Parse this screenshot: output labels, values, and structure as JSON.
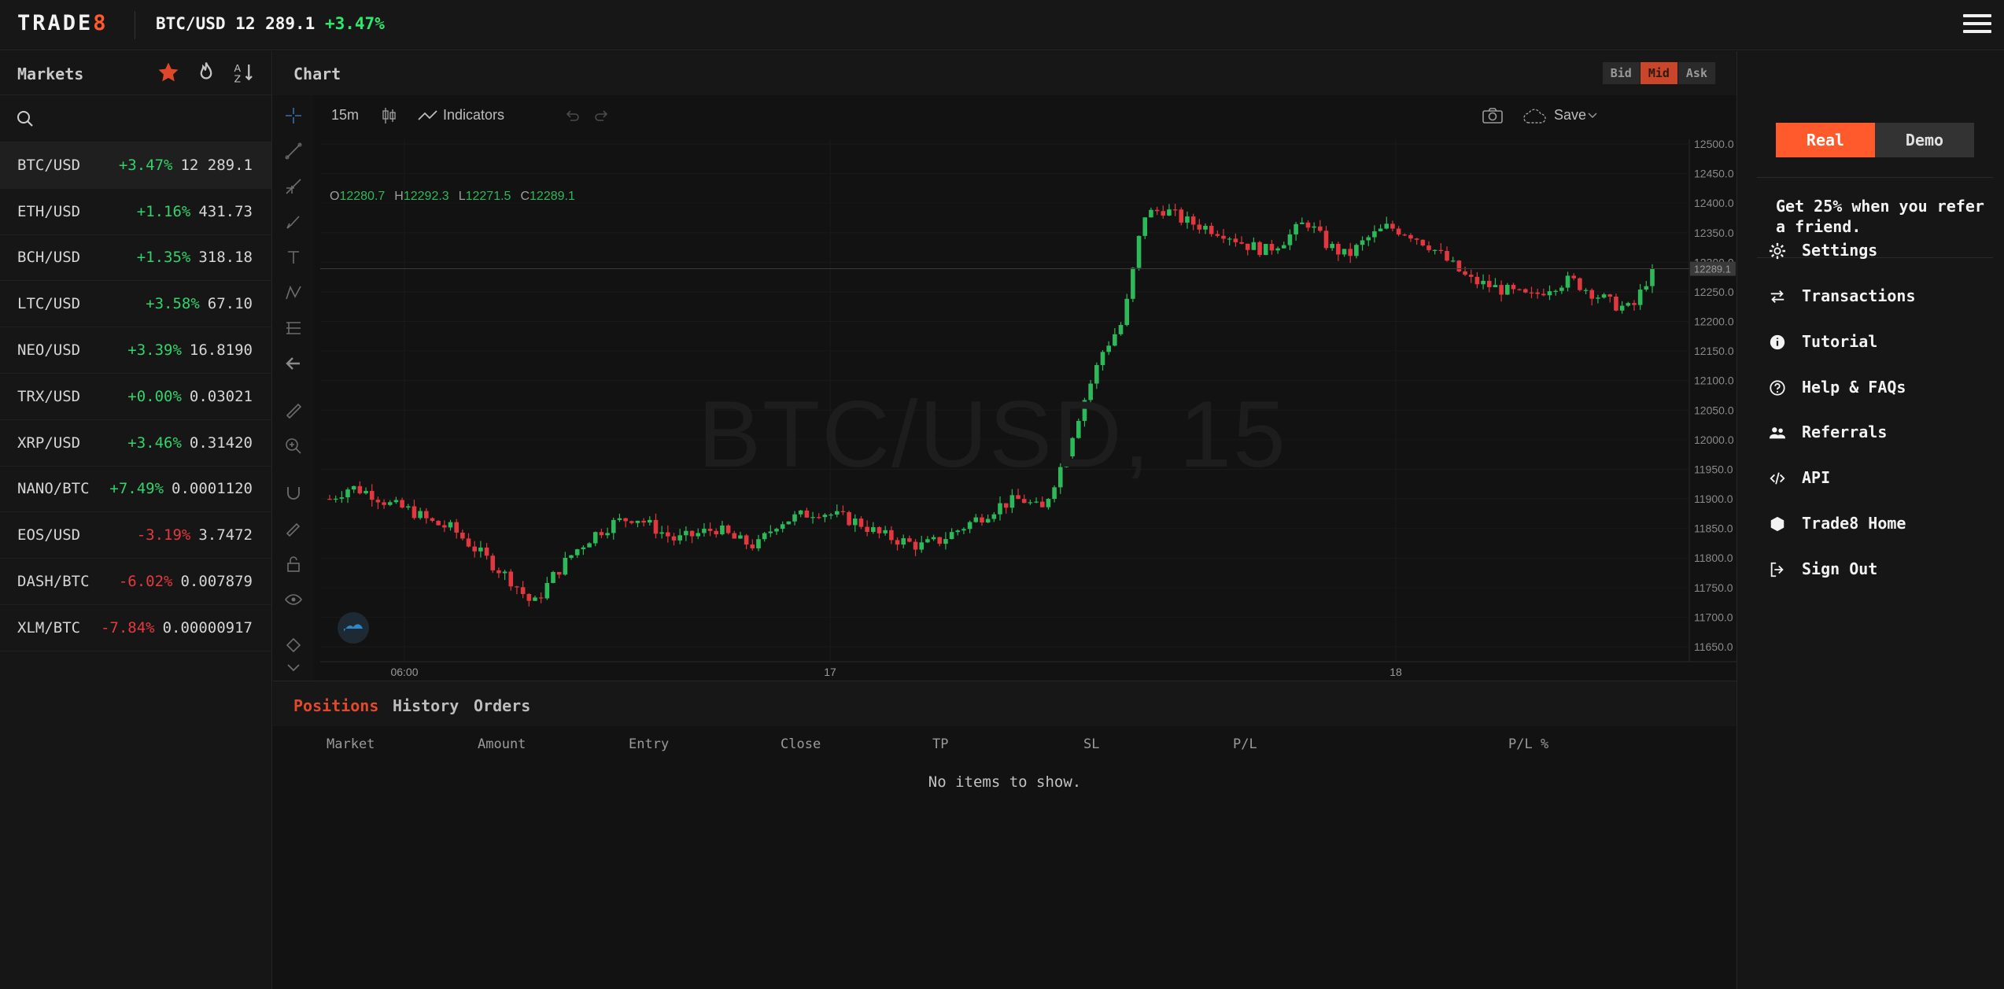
{
  "topbar": {
    "logo": "TRADE",
    "logo_accent": "8",
    "ticker_symbol": "BTC/USD",
    "ticker_price": "12 289.1",
    "ticker_change": "+3.47%"
  },
  "markets": {
    "title": "Markets",
    "search_placeholder": "",
    "rows": [
      {
        "symbol": "BTC/USD",
        "change": "+3.47%",
        "price": "12 289.1",
        "dir": "up",
        "active": true
      },
      {
        "symbol": "ETH/USD",
        "change": "+1.16%",
        "price": "431.73",
        "dir": "up"
      },
      {
        "symbol": "BCH/USD",
        "change": "+1.35%",
        "price": "318.18",
        "dir": "up"
      },
      {
        "symbol": "LTC/USD",
        "change": "+3.58%",
        "price": "67.10",
        "dir": "up"
      },
      {
        "symbol": "NEO/USD",
        "change": "+3.39%",
        "price": "16.8190",
        "dir": "up"
      },
      {
        "symbol": "TRX/USD",
        "change": "+0.00%",
        "price": "0.03021",
        "dir": "flat"
      },
      {
        "symbol": "XRP/USD",
        "change": "+3.46%",
        "price": "0.31420",
        "dir": "up"
      },
      {
        "symbol": "NANO/BTC",
        "change": "+7.49%",
        "price": "0.0001120",
        "dir": "up"
      },
      {
        "symbol": "EOS/USD",
        "change": "-3.19%",
        "price": "3.7472",
        "dir": "down"
      },
      {
        "symbol": "DASH/BTC",
        "change": "-6.02%",
        "price": "0.007879",
        "dir": "down"
      },
      {
        "symbol": "XLM/BTC",
        "change": "-7.84%",
        "price": "0.00000917",
        "dir": "down"
      }
    ]
  },
  "chart": {
    "title": "Chart",
    "price_modes": [
      "Bid",
      "Mid",
      "Ask"
    ],
    "active_mode": "Mid",
    "interval": "15m",
    "indicators_label": "Indicators",
    "save_label": "Save",
    "watermark": "BTC/USD, 15",
    "ohlc": {
      "o_label": "O",
      "o": "12280.7",
      "h_label": "H",
      "h": "12292.3",
      "l_label": "L",
      "l": "12271.5",
      "c_label": "C",
      "c": "12289.1"
    },
    "current_price_tag": "12289.1",
    "colors": {
      "up": "#2db85a",
      "down": "#e0383e",
      "accent": "#ff5a2c"
    }
  },
  "chart_data": {
    "type": "candlestick",
    "title": "",
    "xlabel": "",
    "ylabel": "",
    "ylim": [
      11650,
      12500
    ],
    "y_ticks": [
      "12500.0",
      "12450.0",
      "12400.0",
      "12350.0",
      "12300.0",
      "12250.0",
      "12200.0",
      "12150.0",
      "12100.0",
      "12050.0",
      "12000.0",
      "11950.0",
      "11900.0",
      "11850.0",
      "11800.0",
      "11750.0",
      "11700.0",
      "11650.0"
    ],
    "x_ticks": [
      "06:00",
      "17",
      "18"
    ],
    "close_trace": [
      11900,
      11920,
      11910,
      11890,
      11880,
      11860,
      11850,
      11820,
      11790,
      11760,
      11720,
      11770,
      11810,
      11840,
      11860,
      11870,
      11850,
      11830,
      11840,
      11850,
      11830,
      11820,
      11860,
      11870,
      11880,
      11870,
      11860,
      11840,
      11830,
      11820,
      11830,
      11850,
      11870,
      11890,
      11900,
      11880,
      11960,
      12060,
      12150,
      12200,
      12380,
      12390,
      12370,
      12360,
      12350,
      12330,
      12320,
      12340,
      12370,
      12330,
      12310,
      12340,
      12360,
      12350,
      12330,
      12300,
      12270,
      12260,
      12250,
      12240,
      12260,
      12270,
      12250,
      12230,
      12220,
      12289
    ]
  },
  "positions": {
    "tabs": [
      "Positions",
      "History",
      "Orders"
    ],
    "columns": [
      "Market",
      "Amount",
      "Entry",
      "Close",
      "TP",
      "SL",
      "P/L",
      "P/L %"
    ],
    "empty_text": "No items to show."
  },
  "account": {
    "real_label": "Real",
    "demo_label": "Demo",
    "refer_text": "Get 25% when you refer a friend.",
    "menu": [
      {
        "label": "Settings",
        "icon": "gear-icon"
      },
      {
        "label": "Transactions",
        "icon": "transfer-icon"
      },
      {
        "label": "Tutorial",
        "icon": "info-icon"
      },
      {
        "label": "Help & FAQs",
        "icon": "question-icon"
      },
      {
        "label": "Referrals",
        "icon": "users-icon"
      },
      {
        "label": "API",
        "icon": "code-icon"
      },
      {
        "label": "Trade8 Home",
        "icon": "hexagon-icon"
      },
      {
        "label": "Sign Out",
        "icon": "sign-out-icon"
      }
    ]
  }
}
